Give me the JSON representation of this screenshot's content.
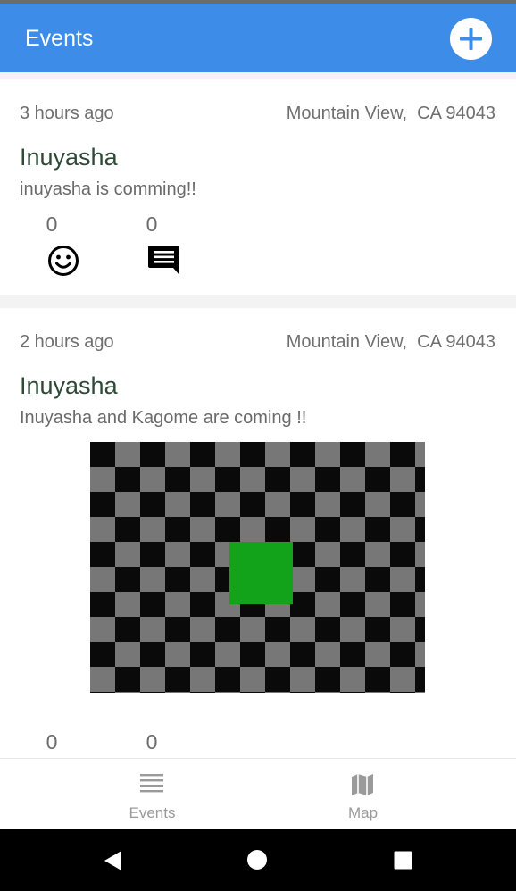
{
  "app_bar": {
    "title": "Events",
    "add_icon": "plus-circle-icon",
    "color": "#3d8ce8"
  },
  "events": [
    {
      "time": "3 hours ago",
      "location": "Mountain View,  CA 94043",
      "title": "Inuyasha",
      "description": "inuyasha is comming!!",
      "reaction_count": "0",
      "comment_count": "0",
      "reaction_icon": "smiley-face-icon",
      "comment_icon": "comment-icon"
    },
    {
      "time": "2 hours ago",
      "location": "Mountain View,  CA 94043",
      "title": "Inuyasha",
      "description": "Inuyasha and Kagome are coming !!",
      "image": "checkerboard-image",
      "reaction_count": "0",
      "comment_count": "0"
    }
  ],
  "bottom_nav": {
    "tabs": [
      {
        "label": "Events",
        "icon": "list-icon"
      },
      {
        "label": "Map",
        "icon": "map-icon"
      }
    ]
  },
  "system_nav": {
    "back_icon": "back-triangle-icon",
    "home_icon": "home-circle-icon",
    "recents_icon": "recents-square-icon"
  }
}
